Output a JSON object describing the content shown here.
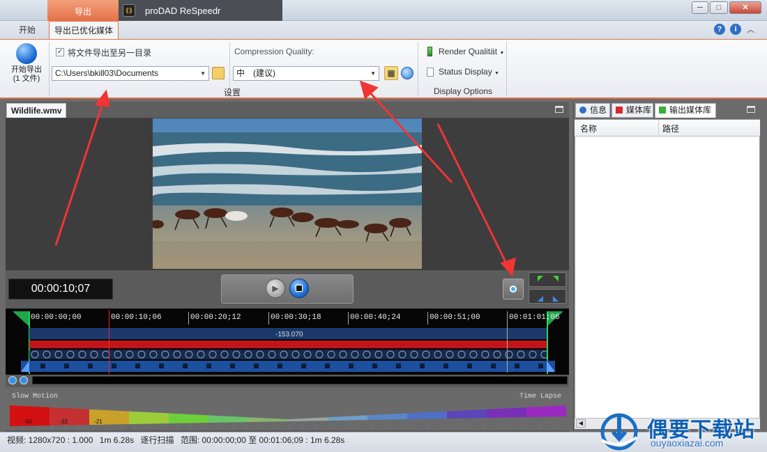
{
  "window": {
    "app_title": "proDAD ReSpeedr",
    "context_tab": "导出",
    "qa_icon": "dropdown-arrow-icon",
    "min_glyph": "─",
    "max_glyph": "□",
    "close_glyph": "✕"
  },
  "ribbon_tabs": [
    "开始",
    "导出已优化媒体"
  ],
  "help": {
    "q": "?",
    "info": "i",
    "collapse": "︿"
  },
  "ribbon": {
    "start_export_line1": "开始导出",
    "start_export_line2": "(1 文件)",
    "export_to_dir_label": "将文件导出至另一目录",
    "export_to_dir_checked": true,
    "check_glyph": "✓",
    "output_path": "C:\\Users\\bkill03\\Documents",
    "settings_group": "设置",
    "compression_label": "Compression Quality:",
    "compression_value": "中　(建议)",
    "render_quality": "Render Qualität",
    "status_display": "Status Display",
    "display_options_group": "Display Options",
    "dropdown_glyph": "▼"
  },
  "preview": {
    "file_tab": "Wildlife.wmv",
    "timecode": "00:00:10;07",
    "play_glyph": "▶"
  },
  "timeline": {
    "ruler": [
      "00:00:00;00",
      "00:00:10;06",
      "00:00:20;12",
      "00:00:30;18",
      "00:00:40;24",
      "00:00:51;00",
      "00:01:01;06"
    ],
    "track_value": "-153.070"
  },
  "speed_curve": {
    "slow_label": "Slow Motion",
    "lapse_label": "Time Lapse",
    "values": [
      "-50",
      "-33",
      "-21"
    ],
    "colors": [
      "#d41111",
      "#c53030",
      "#c9a12a",
      "#9ccc3a",
      "#6fcf3a",
      "#6ac26a",
      "#8cb36f",
      "#9ba59e",
      "#6f9ec9",
      "#5a86c7",
      "#4f6fc7",
      "#5b45b8",
      "#7a2fb8",
      "#9a2ac0"
    ]
  },
  "right_panel": {
    "tabs": [
      "信息",
      "媒体库",
      "输出媒体库"
    ],
    "col_name": "名称",
    "col_path": "路径"
  },
  "statusbar": {
    "video": "视频: 1280x720 : 1.000",
    "duration": "1m 6.28s",
    "scan": "逐行扫描",
    "range": "范围: 00:00:00;00 至 00:01:06;09 : 1m 6.28s"
  },
  "watermark": {
    "text": "偶要下载站",
    "url": "ouyaoxiazai.com"
  }
}
